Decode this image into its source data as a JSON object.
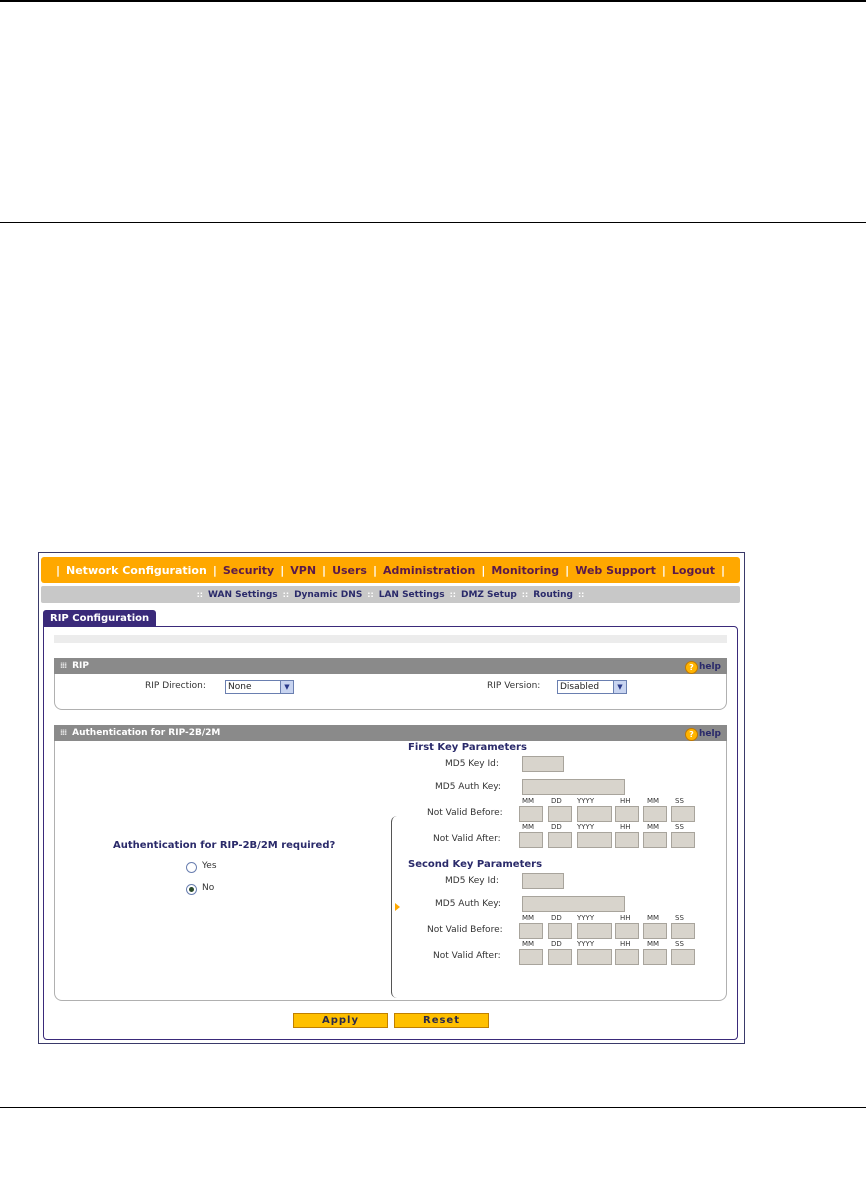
{
  "nav": {
    "items": [
      "Network Configuration",
      "Security",
      "VPN",
      "Users",
      "Administration",
      "Monitoring",
      "Web Support",
      "Logout"
    ]
  },
  "subnav": {
    "items": [
      "WAN Settings",
      "Dynamic DNS",
      "LAN Settings",
      "DMZ Setup",
      "Routing"
    ]
  },
  "tab": {
    "label": "RIP Configuration"
  },
  "rip": {
    "title": "RIP",
    "help": "help",
    "direction_label": "RIP Direction:",
    "direction_value": "None",
    "version_label": "RIP Version:",
    "version_value": "Disabled"
  },
  "auth": {
    "title": "Authentication for RIP-2B/2M",
    "help": "help",
    "question": "Authentication for RIP-2B/2M required?",
    "yes": "Yes",
    "no": "No",
    "selected": "No",
    "first_title": "First Key Parameters",
    "second_title": "Second Key Parameters",
    "key_id_label": "MD5 Key Id:",
    "auth_key_label": "MD5 Auth Key:",
    "valid_before_label": "Not Valid Before:",
    "valid_after_label": "Not Valid After:",
    "date_fields": [
      "MM",
      "DD",
      "YYYY",
      "HH",
      "MM",
      "SS"
    ]
  },
  "buttons": {
    "apply": "Apply",
    "reset": "Reset"
  }
}
